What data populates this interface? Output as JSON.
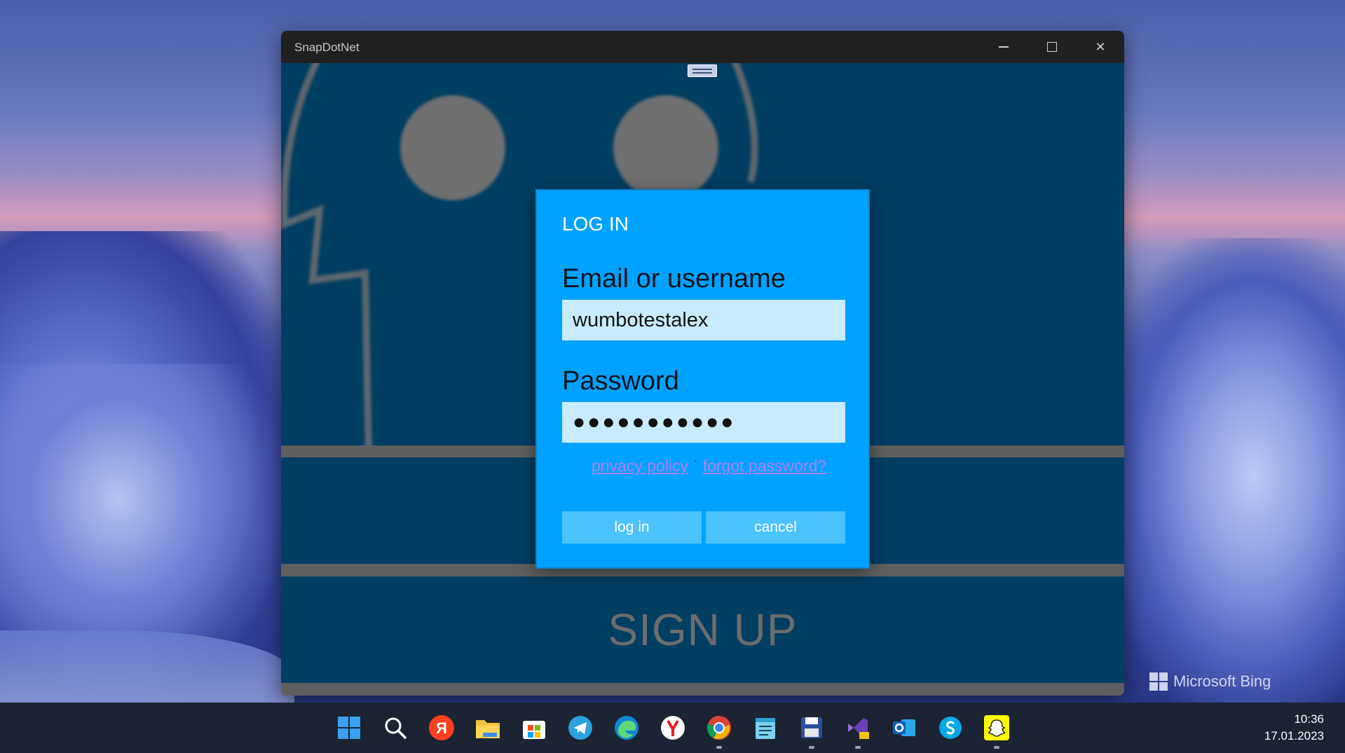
{
  "window": {
    "title": "SnapDotNet",
    "controls": {
      "minimize": "minimize",
      "maximize": "maximize",
      "close": "✕"
    }
  },
  "background_panel": {
    "signup_label": "SIGN UP"
  },
  "login_dialog": {
    "title": "LOG IN",
    "email_label": "Email or username",
    "email_value": "wumbotestalex",
    "password_label": "Password",
    "password_value": "●●●●●●●●●●●",
    "privacy_link": "privacy policy",
    "separator": "·",
    "forgot_link": "forgot password?",
    "login_button": "log in",
    "cancel_button": "cancel"
  },
  "desktop": {
    "watermark": "Microsoft Bing"
  },
  "taskbar": {
    "icons": [
      "windows-start-icon",
      "search-icon",
      "yandex-icon",
      "file-explorer-icon",
      "microsoft-store-icon",
      "telegram-icon",
      "edge-icon",
      "yandex-browser-icon",
      "chrome-icon",
      "notepad-icon",
      "floppy-save-icon",
      "visual-studio-preview-icon",
      "outlook-icon",
      "skype-icon",
      "snapchat-icon"
    ],
    "yandex_letter": "Я",
    "time": "10:36",
    "date": "17.01.2023"
  },
  "colors": {
    "dialog_bg": "#00a2ff",
    "input_bg": "#c8ecff",
    "button_bg": "#4cc2ff",
    "link": "#b37ef0",
    "panel_bg": "#003e63",
    "titlebar_bg": "#202020"
  }
}
